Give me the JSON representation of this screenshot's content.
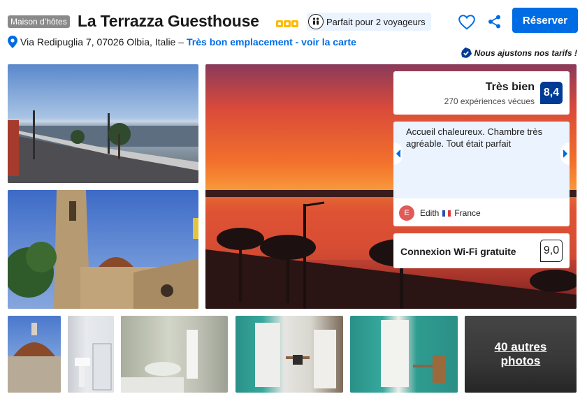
{
  "property": {
    "type_badge": "Maison d’hôtes",
    "name": "La Terrazza Guesthouse",
    "stars": 3,
    "travel_badge": "Parfait pour 2 voyageurs",
    "address": "Via Redipuglia 7, 07026 Olbia, Italie –",
    "map_link": "Très bon emplacement - voir la carte",
    "price_note": "Nous ajustons nos tarifs !"
  },
  "actions": {
    "reserve_label": "Réserver",
    "heart_icon": "heart-icon",
    "share_icon": "share-icon"
  },
  "rating": {
    "label": "Très bien",
    "count": "270 expériences vécues",
    "score": "8,4"
  },
  "review": {
    "quote": "Accueil chaleureux. Chambre très agréable. Tout était parfait",
    "initial": "E",
    "author": "Edith",
    "country": "France"
  },
  "facility": {
    "label": "Connexion Wi-Fi gratuite",
    "score": "9,0"
  },
  "gallery": {
    "more_label": "40 autres photos"
  },
  "colors": {
    "brand_blue": "#006ce4",
    "score_navy": "#003b95",
    "star_yellow": "#febb02",
    "light_blue_bg": "#ebf3ff"
  }
}
